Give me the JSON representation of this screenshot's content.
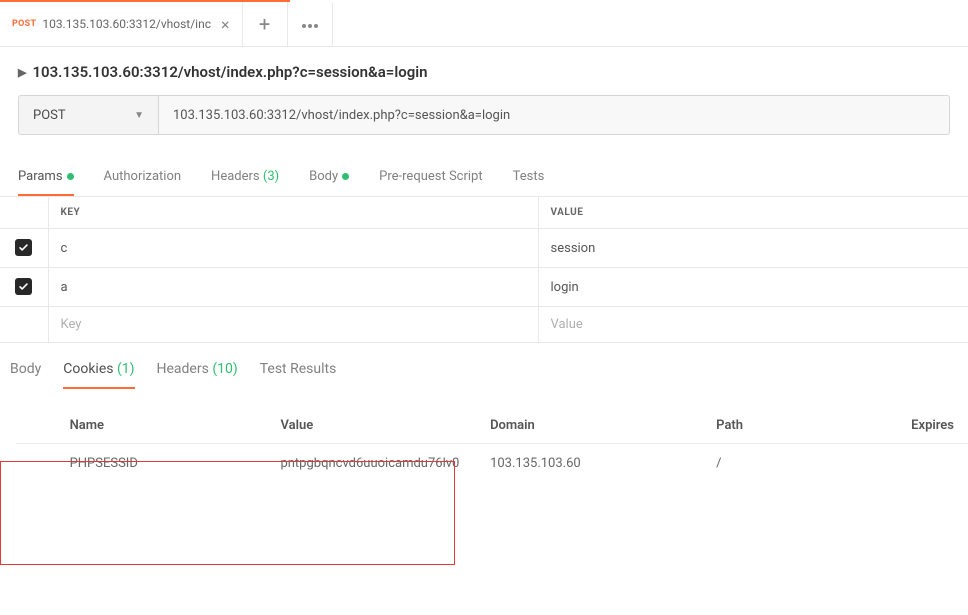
{
  "tab": {
    "method": "POST",
    "title": "103.135.103.60:3312/vhost/inc"
  },
  "request": {
    "summary": "103.135.103.60:3312/vhost/index.php?c=session&a=login",
    "method": "POST",
    "url": "103.135.103.60:3312/vhost/index.php?c=session&a=login"
  },
  "subtabs": {
    "params": "Params",
    "auth": "Authorization",
    "headers": "Headers",
    "headers_count": "(3)",
    "body": "Body",
    "prescript": "Pre-request Script",
    "tests": "Tests"
  },
  "kv": {
    "key_header": "KEY",
    "value_header": "VALUE",
    "rows": [
      {
        "key": "c",
        "value": "session"
      },
      {
        "key": "a",
        "value": "login"
      }
    ],
    "key_placeholder": "Key",
    "value_placeholder": "Value"
  },
  "resp_tabs": {
    "body": "Body",
    "cookies": "Cookies",
    "cookies_count": "(1)",
    "headers": "Headers",
    "headers_count": "(10)",
    "testresults": "Test Results"
  },
  "cookies": {
    "headers": {
      "name": "Name",
      "value": "Value",
      "domain": "Domain",
      "path": "Path",
      "expires": "Expires"
    },
    "rows": [
      {
        "name": "PHPSESSID",
        "value": "pntpgbqncvd6uuoicamdu76lv0",
        "domain": "103.135.103.60",
        "path": "/",
        "expires": ""
      }
    ]
  }
}
